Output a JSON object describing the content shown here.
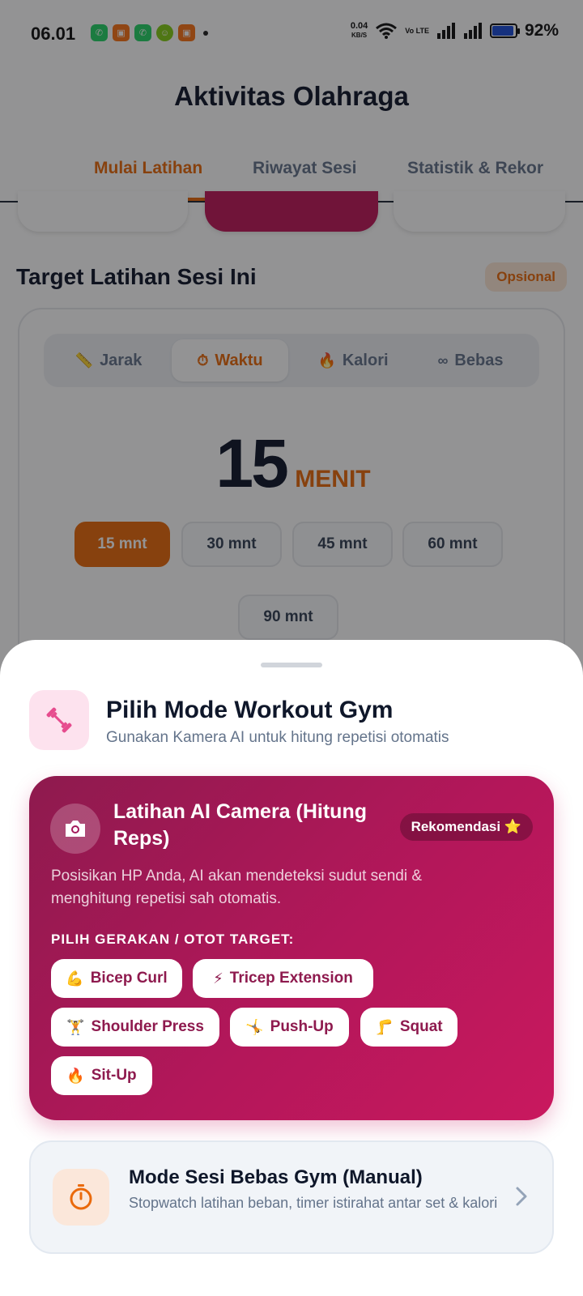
{
  "status_bar": {
    "time": "06.01",
    "net_speed": "0.04",
    "net_unit": "KB/S",
    "volte": "Vo LTE",
    "battery": "92%"
  },
  "header": {
    "title": "Aktivitas Olahraga",
    "tabs": [
      {
        "label": "Mulai Latihan",
        "active": true
      },
      {
        "label": "Riwayat Sesi",
        "active": false
      },
      {
        "label": "Statistik & Rekor",
        "active": false
      }
    ]
  },
  "target": {
    "title": "Target Latihan Sesi Ini",
    "badge": "Opsional",
    "modes": [
      {
        "label": "Jarak",
        "icon": "ruler-icon",
        "active": false
      },
      {
        "label": "Waktu",
        "icon": "stopwatch-icon",
        "active": true
      },
      {
        "label": "Kalori",
        "icon": "flame-icon",
        "active": false
      },
      {
        "label": "Bebas",
        "icon": "infinity-icon",
        "active": false
      }
    ],
    "value": "15",
    "unit": "MENIT",
    "presets": [
      "15 mnt",
      "30 mnt",
      "45 mnt",
      "60 mnt",
      "90 mnt"
    ],
    "selected_preset": "15 mnt"
  },
  "sheet": {
    "title": "Pilih Mode Workout Gym",
    "subtitle": "Gunakan Kamera AI untuk hitung repetisi otomatis",
    "ai": {
      "title": "Latihan AI Camera (Hitung Reps)",
      "badge": "Rekomendasi ⭐",
      "description": "Posisikan HP Anda, AI akan mendeteksi sudut sendi & menghitung repetisi sah otomatis.",
      "label": "PILIH GERAKAN / OTOT TARGET:",
      "moves": [
        {
          "emoji": "💪",
          "label": "Bicep Curl"
        },
        {
          "emoji": "⚡",
          "label": "Tricep Extension"
        },
        {
          "emoji": "🏋",
          "label": "Shoulder Press"
        },
        {
          "emoji": "🤸",
          "label": "Push-Up"
        },
        {
          "emoji": "🦵",
          "label": "Squat"
        },
        {
          "emoji": "🔥",
          "label": "Sit-Up"
        }
      ]
    },
    "manual": {
      "title": "Mode Sesi Bebas Gym (Manual)",
      "description": "Stopwatch latihan beban, timer istirahat antar set & kalori"
    }
  },
  "colors": {
    "accent": "#ea6a0c",
    "brand": "#b3175a",
    "text": "#0f172a"
  }
}
